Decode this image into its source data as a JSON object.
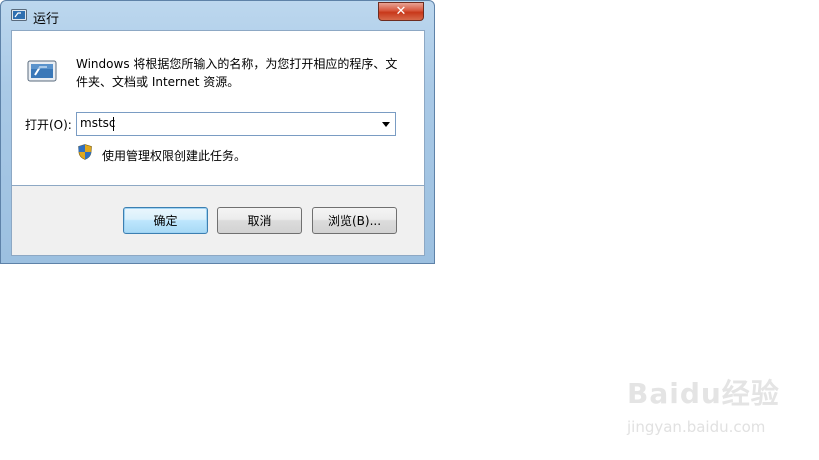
{
  "window": {
    "title": "运行",
    "close_glyph": "✕"
  },
  "content": {
    "description": "Windows 将根据您所输入的名称，为您打开相应的程序、文件夹、文档或 Internet 资源。",
    "open_label": "打开(O):",
    "open_value": "mstsc",
    "admin_note": "使用管理权限创建此任务。"
  },
  "buttons": {
    "ok": "确定",
    "cancel": "取消",
    "browse": "浏览(B)..."
  },
  "watermark": {
    "logo": "Baidu经验",
    "url": "jingyan.baidu.com"
  },
  "icons": {
    "title": "run-icon",
    "app": "run-program-icon",
    "shield": "uac-shield-icon",
    "dropdown": "dropdown-arrow-icon"
  },
  "colors": {
    "titlebar": "#a9c9e6",
    "close_button": "#c8381a",
    "default_button_border": "#3c7fb1"
  }
}
